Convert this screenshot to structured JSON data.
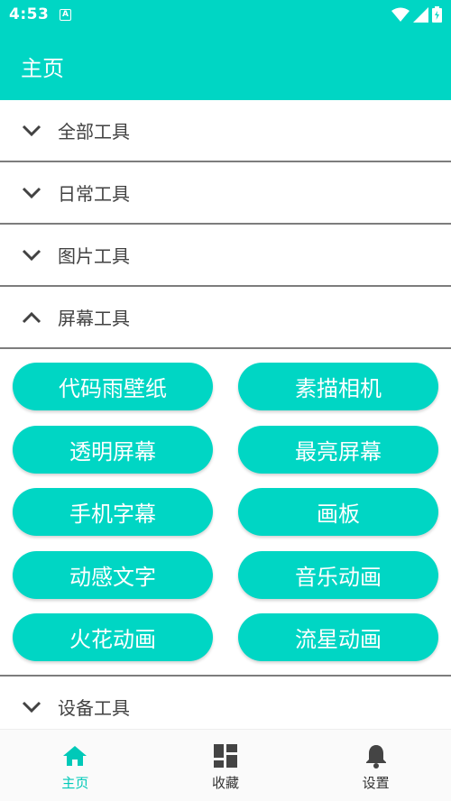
{
  "status": {
    "time": "4:53",
    "notif_letter": "A"
  },
  "appbar": {
    "title": "主页"
  },
  "sections": {
    "all": "全部工具",
    "daily": "日常工具",
    "image": "图片工具",
    "screen": "屏幕工具",
    "device": "设备工具"
  },
  "screen_tools": [
    "代码雨壁纸",
    "素描相机",
    "透明屏幕",
    "最亮屏幕",
    "手机字幕",
    "画板",
    "动感文字",
    "音乐动画",
    "火花动画",
    "流星动画"
  ],
  "nav": {
    "home": "主页",
    "favorites": "收藏",
    "settings": "设置"
  },
  "colors": {
    "accent": "#00d6c4",
    "divider": "#7d7d7d",
    "text": "#424242"
  },
  "icons": {
    "chevron_down": "chevron-down-icon",
    "chevron_up": "chevron-up-icon",
    "home": "home-icon",
    "dashboard": "dashboard-icon",
    "bell": "bell-icon"
  }
}
